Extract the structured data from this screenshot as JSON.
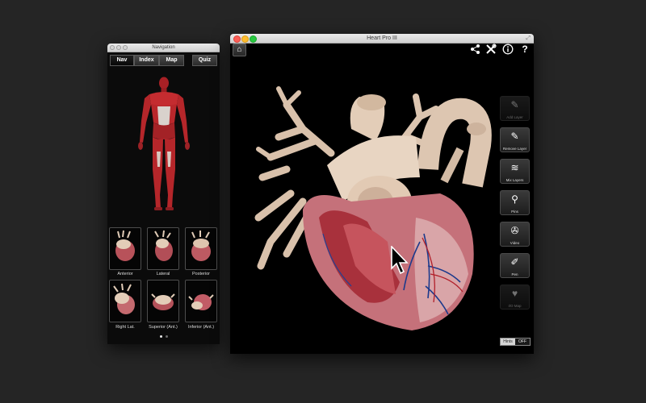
{
  "navigation": {
    "title": "Navigation",
    "tabs": [
      {
        "label": "Nav",
        "active": true
      },
      {
        "label": "Index",
        "active": false
      },
      {
        "label": "Map",
        "active": false
      }
    ],
    "quiz_label": "Quiz",
    "views": [
      {
        "label": "Anterior"
      },
      {
        "label": "Lateral"
      },
      {
        "label": "Posterior"
      },
      {
        "label": "Right Lat."
      },
      {
        "label": "Superior (Ant.)"
      },
      {
        "label": "Inferior (Ant.)"
      }
    ],
    "page_dots": {
      "count": 2,
      "active_index": 0
    }
  },
  "main": {
    "title": "Heart Pro III",
    "tools": [
      {
        "label": "Add Layer",
        "icon": "brush-plus-icon",
        "enabled": false
      },
      {
        "label": "Remove Layer",
        "icon": "brush-minus-icon",
        "enabled": true
      },
      {
        "label": "Mix Layers",
        "icon": "layers-icon",
        "enabled": true
      },
      {
        "label": "Pins",
        "icon": "pin-icon",
        "enabled": true
      },
      {
        "label": "Video",
        "icon": "film-reel-icon",
        "enabled": true
      },
      {
        "label": "Pen",
        "icon": "pen-icon",
        "enabled": true
      },
      {
        "label": "I/O Map",
        "icon": "heart-icon",
        "enabled": false
      }
    ],
    "hints": {
      "label": "Hints",
      "state": "OFF"
    }
  },
  "colors": {
    "desktop": "#252525",
    "muscle_red": "#b5262a",
    "heart_tissue": "#b8525a",
    "vessel_cream": "#e3cdb8"
  }
}
